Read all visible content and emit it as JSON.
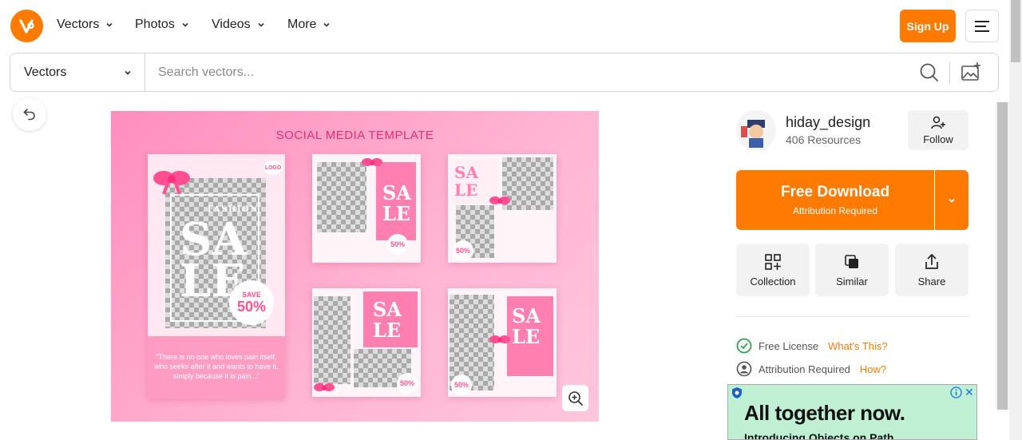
{
  "nav": {
    "items": [
      {
        "label": "Vectors"
      },
      {
        "label": "Photos"
      },
      {
        "label": "Videos"
      },
      {
        "label": "More"
      }
    ],
    "signup_label": "Sign Up",
    "menu_icon": "hamburger-menu-icon"
  },
  "search": {
    "type_selected": "Vectors",
    "placeholder": "Search vectors...",
    "value": ""
  },
  "preview": {
    "template_title": "SOCIAL MEDIA TEMPLATE",
    "logo_badge": "LOGO",
    "fashion_label": "FASHION",
    "sale_line1": "SA",
    "sale_line2": "LE",
    "save_label": "SAVE",
    "save_value": "50%",
    "quote": "\"There is no one who loves pain itself, who seeks after it and wants to have it, simply because it is pain...\""
  },
  "author": {
    "name": "hiday_design",
    "resources": "406 Resources",
    "follow_label": "Follow"
  },
  "download": {
    "label": "Free Download",
    "sublabel": "Attribution Required"
  },
  "actions": [
    {
      "label": "Collection"
    },
    {
      "label": "Similar"
    },
    {
      "label": "Share"
    }
  ],
  "license": {
    "free_label": "Free License",
    "free_link": "What's This?",
    "attr_label": "Attribution Required",
    "attr_link": "How?"
  },
  "ad": {
    "headline": "All together now.",
    "subline": "Introducing Objects on Path"
  },
  "colors": {
    "brand_orange": "#ff7a00",
    "preview_pink": "#ff8ebd",
    "accent_pink": "#e0307a",
    "ad_green": "#bff0d4"
  }
}
